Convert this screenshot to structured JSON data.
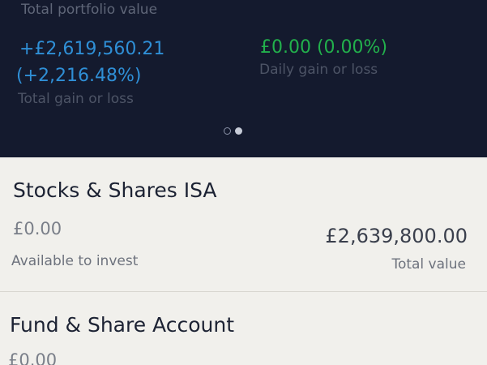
{
  "summary": {
    "total_portfolio_label": "Total portfolio value",
    "total_gain_value": "+£2,619,560.21",
    "total_gain_percent": "(+2,216.48%)",
    "total_gain_label": "Total gain or loss",
    "daily_gain_value": "£0.00 (0.00%)",
    "daily_gain_label": "Daily gain or loss",
    "pager": {
      "pages": 2,
      "active_index": 1
    },
    "colors": {
      "background": "#141a2e",
      "gain": "#2f8fd6",
      "daily": "#22b14c"
    }
  },
  "accounts": [
    {
      "name": "Stocks & Shares ISA",
      "available_value": "£0.00",
      "available_label": "Available to invest",
      "total_value": "£2,639,800.00",
      "total_label": "Total value"
    },
    {
      "name": "Fund & Share Account",
      "available_value": "£0.00"
    }
  ]
}
